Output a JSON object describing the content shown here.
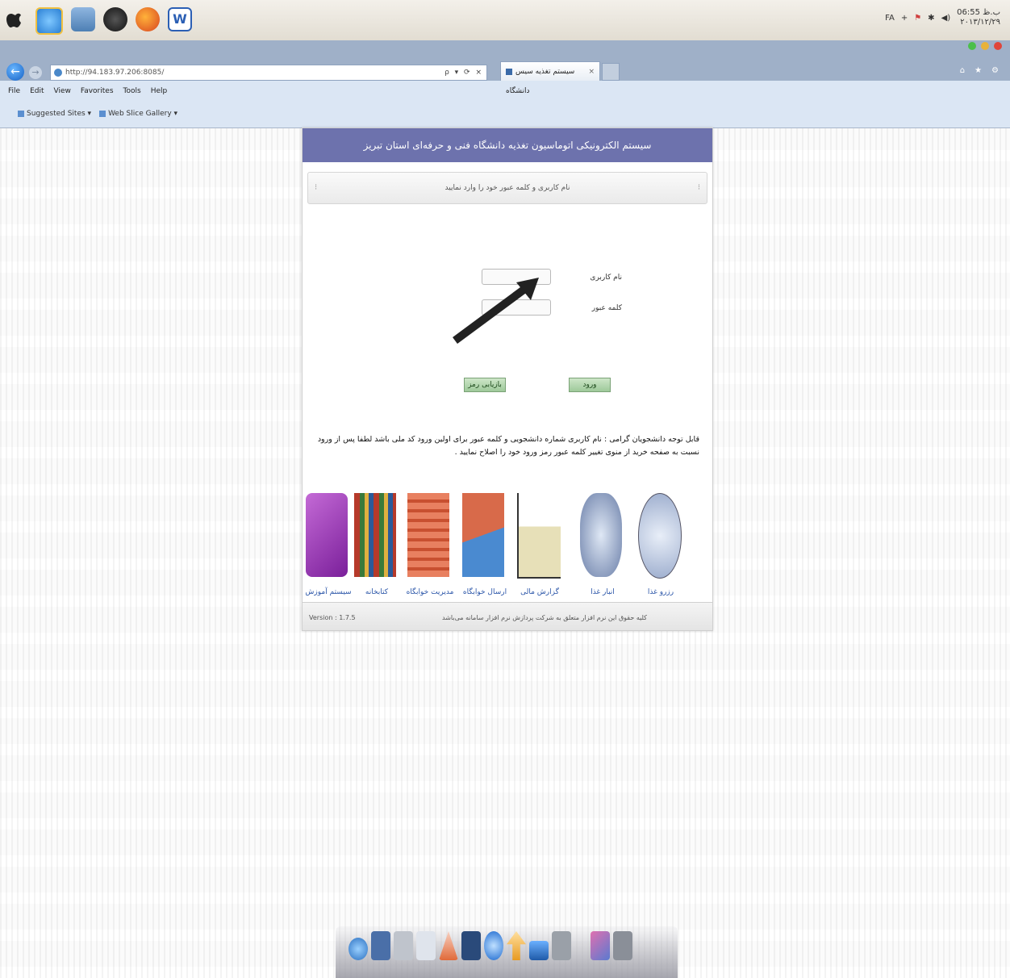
{
  "browser": {
    "address": "http://94.183.97.206:8085/",
    "address_controls": "ρ ▾ ⟳ × ",
    "tab_title": "سیستم تغذیه سیس دانشگاه",
    "tab_close": "×",
    "menu": [
      "File",
      "Edit",
      "View",
      "Favorites",
      "Tools",
      "Help"
    ],
    "favorites": [
      "Suggested Sites ▾",
      "Web Slice Gallery ▾"
    ]
  },
  "tray": {
    "lang": "FA",
    "time": "06:55 ب.ظ",
    "date": "۲۰۱۳/۱۲/۲۹"
  },
  "page": {
    "header_title": "سیستم الکترونیکی اتوماسیون تغذیه دانشگاه فنی و حرفه‌ای استان تبریز",
    "sub_message": "نام کاربری و کلمه عبور خود را وارد نمایید",
    "username_label": "نام کاربری",
    "password_label": "کلمه عبور",
    "login_button": "ورود",
    "recover_button": "بازیابی رمز",
    "note": "قابل توجه دانشجویان گرامی : نام کاربری شماره دانشجویی و کلمه عبور برای اولین ورود کد ملی باشد لطفا پس از ورود نسبت به صفحه خرید از منوی تغییر کلمه عبور رمز ورود خود را اصلاح نمایید .",
    "modules": [
      {
        "label": "رزرو غذا",
        "icon": "dining-icon"
      },
      {
        "label": "انبار غذا",
        "icon": "database-icon"
      },
      {
        "label": "گزارش مالی",
        "icon": "finance-chart-icon"
      },
      {
        "label": "ارسال خوابگاه",
        "icon": "dorm-transfer-icon"
      },
      {
        "label": "مدیریت خوابگاه",
        "icon": "dorm-building-icon"
      },
      {
        "label": "کتابخانه",
        "icon": "library-icon"
      },
      {
        "label": "سیستم آموزش",
        "icon": "education-icon"
      }
    ],
    "footer_version": "Version : 1.7.5",
    "footer_copy": "کلیه حقوق این نرم افزار متعلق به شرکت پردازش نرم افزار سامانه می‌باشد"
  },
  "colors": {
    "header": "#6d72ad",
    "button": "#9ec99a",
    "link": "#2a55a8"
  }
}
